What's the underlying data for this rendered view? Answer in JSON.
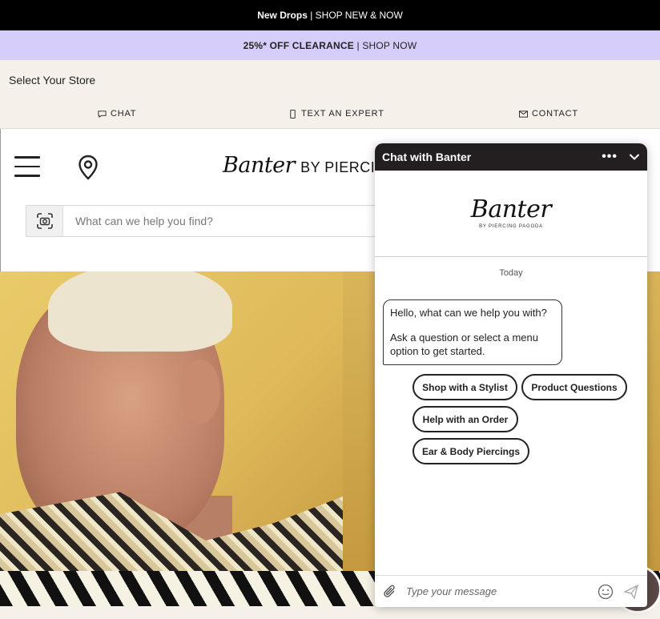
{
  "top_banner": {
    "bold": "New Drops",
    "separator": " | ",
    "link": "SHOP NEW & NOW"
  },
  "promo_banner": {
    "bold": "25%* OFF CLEARANCE",
    "separator": " | ",
    "link": "SHOP NOW"
  },
  "store_select": {
    "label": "Select Your Store"
  },
  "contact_bar": {
    "chat": "CHAT",
    "text_expert": "TEXT AN EXPERT",
    "contact": "CONTACT"
  },
  "header": {
    "logo_script": "Banter",
    "logo_by": "BY PIERCING",
    "search_placeholder": "What can we help you find?"
  },
  "chat_widget": {
    "title": "Chat with Banter",
    "logo_script": "Banter",
    "logo_sub": "BY PIERCING PAGODA",
    "date_label": "Today",
    "message_line1": "Hello, what can we help you with?",
    "message_line2": "Ask a question or select a menu option to get started.",
    "quick_replies": [
      "Shop with a Stylist",
      "Product Questions",
      "Help with an Order",
      "Ear & Body Piercings"
    ],
    "input_placeholder": "Type your message"
  },
  "colors": {
    "top_banner_bg": "#000000",
    "promo_bg": "#d6cdfb",
    "store_bar_bg": "#f5f1ea",
    "chat_header_bg": "#231f20"
  }
}
